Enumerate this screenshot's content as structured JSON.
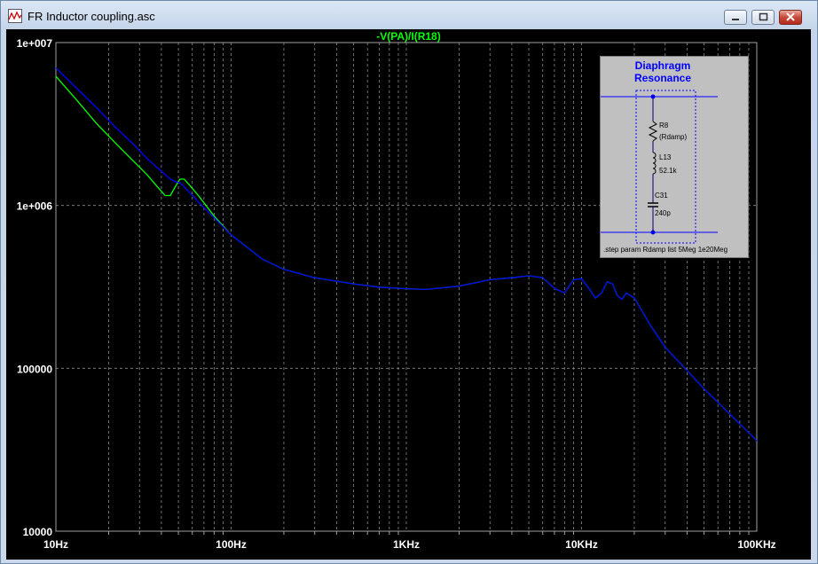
{
  "window": {
    "title": "FR Inductor coupling.asc",
    "buttons": {
      "minimize": "minimize",
      "restore": "restore",
      "close": "close"
    }
  },
  "colors": {
    "background": "#000000",
    "grid": "#8a8a8a",
    "trace_rdamp_5meg": "#00ff00",
    "trace_rdamp_1e20meg": "#0000ff",
    "schematic_bg": "#c0c0c0",
    "schematic_title": "#0000ff",
    "tick_label": "#ffffff"
  },
  "chart_data": {
    "type": "line",
    "title": "-V(PA)/I(R18)",
    "x_scale": "log",
    "y_scale": "log",
    "xlim": [
      10,
      100000
    ],
    "ylim": [
      10000,
      10000000
    ],
    "x_ticks": [
      {
        "value": 10,
        "label": "10Hz"
      },
      {
        "value": 100,
        "label": "100Hz"
      },
      {
        "value": 1000,
        "label": "1KHz"
      },
      {
        "value": 10000,
        "label": "10KHz"
      },
      {
        "value": 100000,
        "label": "100KHz"
      }
    ],
    "y_ticks": [
      {
        "value": 10000000,
        "label": "1e+007"
      },
      {
        "value": 1000000,
        "label": "1e+006"
      },
      {
        "value": 100000,
        "label": "100000"
      },
      {
        "value": 10000,
        "label": "10000"
      }
    ],
    "grid": true,
    "series": [
      {
        "color": "#00ff00",
        "x": [
          10,
          13,
          17,
          22,
          28,
          33,
          38,
          42,
          45,
          48,
          51,
          54,
          58,
          65,
          80,
          100,
          150,
          200,
          300,
          500,
          700,
          1000,
          1300,
          2000,
          3000,
          4000,
          5000,
          6000,
          7000,
          8000,
          9000,
          10000,
          11000,
          12000,
          13000,
          14000,
          15000,
          16000,
          17000,
          18000,
          20000,
          25000,
          30000,
          50000,
          100000
        ],
        "y": [
          6200000,
          4500000,
          3200000,
          2400000,
          1850000,
          1550000,
          1300000,
          1150000,
          1150000,
          1300000,
          1450000,
          1450000,
          1330000,
          1150000,
          860000,
          660000,
          470000,
          405000,
          360000,
          330000,
          315000,
          308000,
          305000,
          320000,
          350000,
          360000,
          370000,
          360000,
          310000,
          290000,
          350000,
          355000,
          310000,
          270000,
          290000,
          340000,
          330000,
          280000,
          265000,
          290000,
          270000,
          180000,
          135000,
          75000,
          36000
        ]
      },
      {
        "color": "#0000ff",
        "x": [
          10,
          13,
          17,
          22,
          28,
          33,
          38,
          42,
          45,
          48,
          51,
          54,
          58,
          65,
          80,
          100,
          150,
          200,
          300,
          500,
          700,
          1000,
          1300,
          2000,
          3000,
          4000,
          5000,
          6000,
          7000,
          8000,
          9000,
          10000,
          11000,
          12000,
          13000,
          14000,
          15000,
          16000,
          17000,
          18000,
          20000,
          25000,
          30000,
          50000,
          100000
        ],
        "y": [
          7000000,
          5300000,
          4000000,
          3000000,
          2350000,
          1950000,
          1700000,
          1550000,
          1450000,
          1400000,
          1380000,
          1300000,
          1200000,
          1050000,
          840000,
          660000,
          470000,
          405000,
          360000,
          330000,
          315000,
          308000,
          305000,
          320000,
          350000,
          360000,
          370000,
          360000,
          310000,
          290000,
          350000,
          355000,
          310000,
          270000,
          290000,
          340000,
          330000,
          280000,
          265000,
          290000,
          270000,
          180000,
          135000,
          75000,
          36000
        ]
      }
    ]
  },
  "schematic": {
    "title_line1": "Diaphragm",
    "title_line2": "Resonance",
    "r_name": "R8",
    "r_value": "(Rdamp)",
    "l_name": "L13",
    "l_value": "52.1k",
    "c_name": "C31",
    "c_value": "240p",
    "directive": ".step param Rdamp list 5Meg 1e20Meg"
  }
}
